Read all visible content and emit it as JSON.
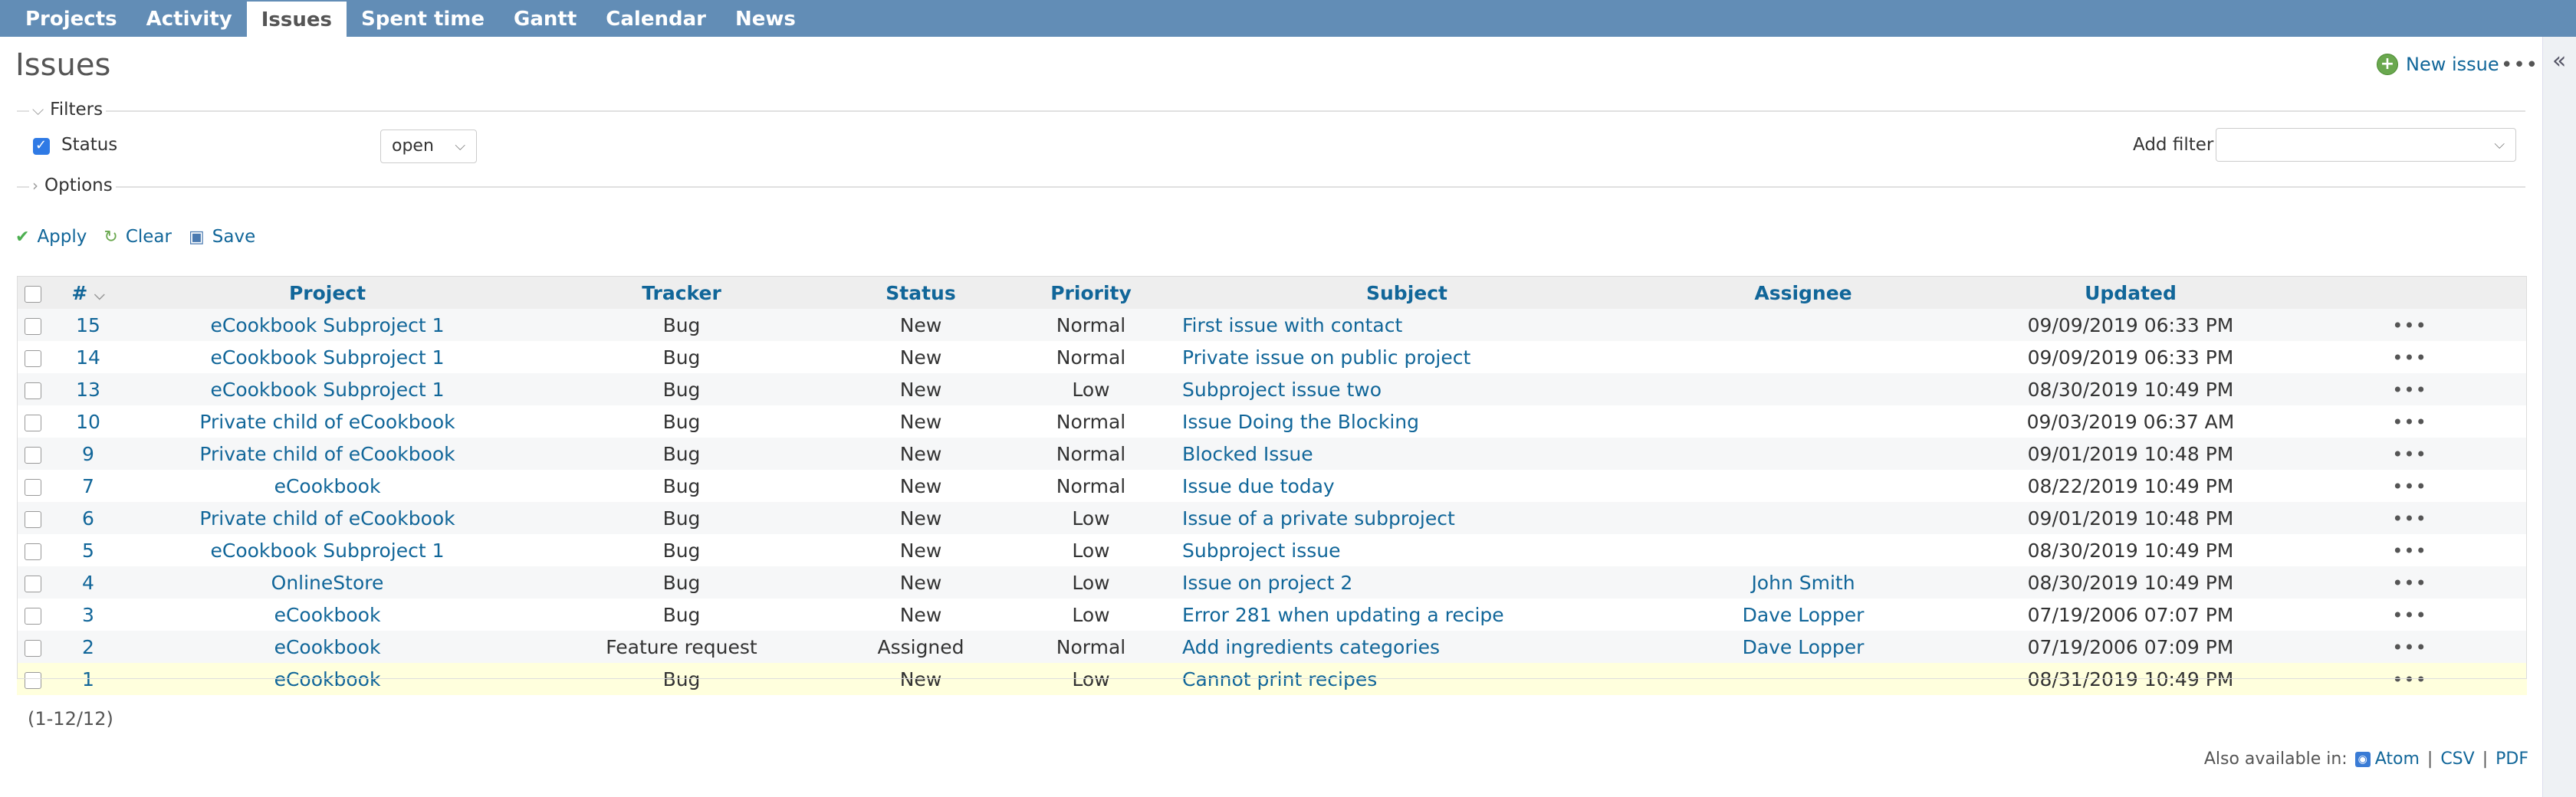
{
  "nav": {
    "tabs": [
      {
        "label": "Projects"
      },
      {
        "label": "Activity"
      },
      {
        "label": "Issues",
        "selected": true
      },
      {
        "label": "Spent time"
      },
      {
        "label": "Gantt"
      },
      {
        "label": "Calendar"
      },
      {
        "label": "News"
      }
    ]
  },
  "page": {
    "title": "Issues",
    "new_issue_label": "New issue",
    "more_label": "•••"
  },
  "filters": {
    "legend": "Filters",
    "status_label": "Status",
    "status_checked": true,
    "status_operator": "open",
    "add_filter_label": "Add filter",
    "add_filter_value": "",
    "options_legend": "Options"
  },
  "actions": {
    "apply": "Apply",
    "clear": "Clear",
    "save": "Save"
  },
  "table": {
    "columns": [
      "#",
      "Project",
      "Tracker",
      "Status",
      "Priority",
      "Subject",
      "Assignee",
      "Updated"
    ],
    "rows": [
      {
        "id": "15",
        "project": "eCookbook Subproject 1",
        "tracker": "Bug",
        "status": "New",
        "priority": "Normal",
        "subject": "First issue with contact",
        "assignee": "",
        "updated": "09/09/2019 06:33 PM"
      },
      {
        "id": "14",
        "project": "eCookbook Subproject 1",
        "tracker": "Bug",
        "status": "New",
        "priority": "Normal",
        "subject": "Private issue on public project",
        "assignee": "",
        "updated": "09/09/2019 06:33 PM"
      },
      {
        "id": "13",
        "project": "eCookbook Subproject 1",
        "tracker": "Bug",
        "status": "New",
        "priority": "Low",
        "subject": "Subproject issue two",
        "assignee": "",
        "updated": "08/30/2019 10:49 PM"
      },
      {
        "id": "10",
        "project": "Private child of eCookbook",
        "tracker": "Bug",
        "status": "New",
        "priority": "Normal",
        "subject": "Issue Doing the Blocking",
        "assignee": "",
        "updated": "09/03/2019 06:37 AM"
      },
      {
        "id": "9",
        "project": "Private child of eCookbook",
        "tracker": "Bug",
        "status": "New",
        "priority": "Normal",
        "subject": "Blocked Issue",
        "assignee": "",
        "updated": "09/01/2019 10:48 PM"
      },
      {
        "id": "7",
        "project": "eCookbook",
        "tracker": "Bug",
        "status": "New",
        "priority": "Normal",
        "subject": "Issue due today",
        "assignee": "",
        "updated": "08/22/2019 10:49 PM"
      },
      {
        "id": "6",
        "project": "Private child of eCookbook",
        "tracker": "Bug",
        "status": "New",
        "priority": "Low",
        "subject": "Issue of a private subproject",
        "assignee": "",
        "updated": "09/01/2019 10:48 PM"
      },
      {
        "id": "5",
        "project": "eCookbook Subproject 1",
        "tracker": "Bug",
        "status": "New",
        "priority": "Low",
        "subject": "Subproject issue",
        "assignee": "",
        "updated": "08/30/2019 10:49 PM"
      },
      {
        "id": "4",
        "project": "OnlineStore",
        "tracker": "Bug",
        "status": "New",
        "priority": "Low",
        "subject": "Issue on project 2",
        "assignee": "John Smith",
        "updated": "08/30/2019 10:49 PM"
      },
      {
        "id": "3",
        "project": "eCookbook",
        "tracker": "Bug",
        "status": "New",
        "priority": "Low",
        "subject": "Error 281 when updating a recipe",
        "assignee": "Dave Lopper",
        "updated": "07/19/2006 07:07 PM"
      },
      {
        "id": "2",
        "project": "eCookbook",
        "tracker": "Feature request",
        "status": "Assigned",
        "priority": "Normal",
        "subject": "Add ingredients categories",
        "assignee": "Dave Lopper",
        "updated": "07/19/2006 07:09 PM"
      },
      {
        "id": "1",
        "project": "eCookbook",
        "tracker": "Bug",
        "status": "New",
        "priority": "Low",
        "subject": "Cannot print recipes",
        "assignee": "",
        "updated": "08/31/2019 10:49 PM"
      }
    ],
    "highlighted_row_id": "1",
    "row_menu_label": "•••"
  },
  "pagination": {
    "text": "(1-12/12)"
  },
  "other_formats": {
    "label": "Also available in:",
    "atom": "Atom",
    "csv": "CSV",
    "pdf": "PDF"
  },
  "colors": {
    "topbar": "#628db6",
    "link": "#116699",
    "highlight_row": "#ffffdd"
  }
}
